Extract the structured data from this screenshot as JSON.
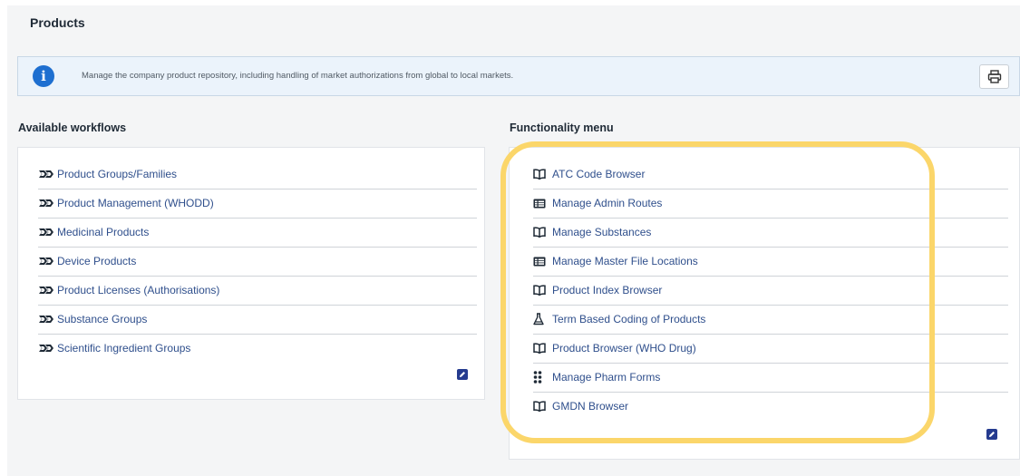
{
  "page": {
    "title": "Products"
  },
  "info": {
    "text": "Manage the company product repository, including handling of market authorizations from global to local markets.",
    "icon": "info-icon",
    "print_icon": "print-icon"
  },
  "workflows": {
    "title": "Available workflows",
    "items": [
      {
        "label": "Product Groups/Families",
        "icon": "workflow-icon"
      },
      {
        "label": "Product Management (WHODD)",
        "icon": "workflow-icon"
      },
      {
        "label": "Medicinal Products",
        "icon": "workflow-icon"
      },
      {
        "label": "Device Products",
        "icon": "workflow-icon"
      },
      {
        "label": "Product Licenses (Authorisations)",
        "icon": "workflow-icon"
      },
      {
        "label": "Substance Groups",
        "icon": "workflow-icon"
      },
      {
        "label": "Scientific Ingredient Groups",
        "icon": "workflow-icon"
      }
    ],
    "edit_icon": "edit-icon"
  },
  "functionality": {
    "title": "Functionality menu",
    "items": [
      {
        "label": "ATC Code Browser",
        "icon": "book-icon"
      },
      {
        "label": "Manage Admin Routes",
        "icon": "table-icon"
      },
      {
        "label": "Manage Substances",
        "icon": "book-icon"
      },
      {
        "label": "Manage Master File Locations",
        "icon": "table-icon"
      },
      {
        "label": "Product Index Browser",
        "icon": "book-icon"
      },
      {
        "label": "Term Based Coding of Products",
        "icon": "flask-icon"
      },
      {
        "label": "Product Browser (WHO Drug)",
        "icon": "book-icon"
      },
      {
        "label": "Manage Pharm Forms",
        "icon": "grid-icon"
      },
      {
        "label": "GMDN Browser",
        "icon": "book-icon"
      }
    ],
    "edit_icon": "edit-icon"
  },
  "colors": {
    "link": "#2f4f8c",
    "highlight": "#fbd66a",
    "info_icon": "#1e6fd0",
    "edit_button": "#253b8f"
  }
}
